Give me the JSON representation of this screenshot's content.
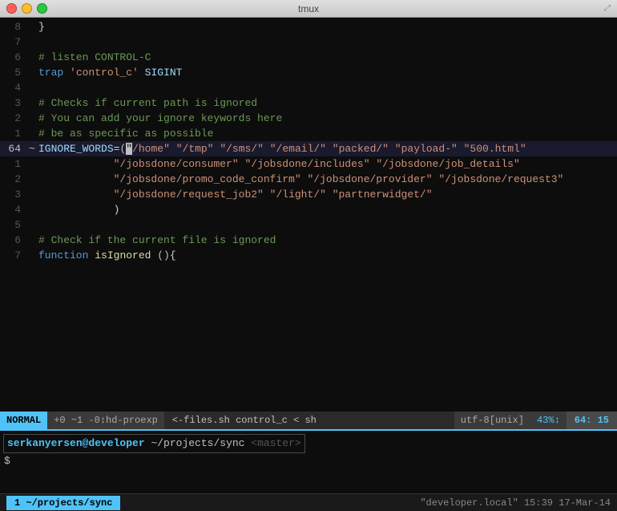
{
  "titlebar": {
    "title": "tmux",
    "buttons": {
      "close": "close",
      "minimize": "minimize",
      "maximize": "maximize"
    }
  },
  "editor": {
    "lines": [
      {
        "num": "8",
        "tilde": false,
        "content": "}"
      },
      {
        "num": "7",
        "tilde": false,
        "content": ""
      },
      {
        "num": "6",
        "tilde": false,
        "content": "# listen CONTROL-C"
      },
      {
        "num": "5",
        "tilde": false,
        "content": "trap 'control_c' SIGINT"
      },
      {
        "num": "4",
        "tilde": false,
        "content": ""
      },
      {
        "num": "3",
        "tilde": false,
        "content": "# Checks if current path is ignored"
      },
      {
        "num": "2",
        "tilde": false,
        "content": "# You can add your ignore keywords here"
      },
      {
        "num": "1",
        "tilde": false,
        "content": "# be as specific as possible"
      },
      {
        "num": "64",
        "tilde": true,
        "content": "IGNORE_WORDS=(\"/home\" \"/tmp\" \"/sms/\" \"/email/\" \"packed/\" \"payload-\" \"500.html\"",
        "current": true
      },
      {
        "num": "1",
        "tilde": false,
        "content": "            \"/jobsdone/consumer\" \"/jobsdone/includes\" \"/jobsdone/job_details\""
      },
      {
        "num": "2",
        "tilde": false,
        "content": "            \"/jobsdone/promo_code_confirm\" \"/jobsdone/provider\" \"/jobsdone/request3\""
      },
      {
        "num": "3",
        "tilde": false,
        "content": "            \"/jobsdone/request_job2\" \"/light/\" \"partnerwidget/\""
      },
      {
        "num": "4",
        "tilde": false,
        "content": "            )"
      },
      {
        "num": "5",
        "tilde": false,
        "content": ""
      },
      {
        "num": "6",
        "tilde": false,
        "content": "# Check if the current file is ignored"
      },
      {
        "num": "7",
        "tilde": false,
        "content": "function isIgnored (){"
      }
    ]
  },
  "statusbar": {
    "mode": "NORMAL",
    "git": "+0 ~1 -0",
    "branch": "hd-proexp",
    "files": "<-files.sh",
    "extra": "control_c < sh",
    "encoding": "utf-8[unix]",
    "percent": "43%",
    "position": "64: 15"
  },
  "shell": {
    "user": "serkanyersen@developer",
    "dir": "~/projects/sync",
    "branch": "<master>",
    "dollar": "$"
  },
  "bottombar": {
    "tab": "1 ~/projects/sync",
    "info": "\"developer.local\" 15:39 17-Mar-14"
  }
}
